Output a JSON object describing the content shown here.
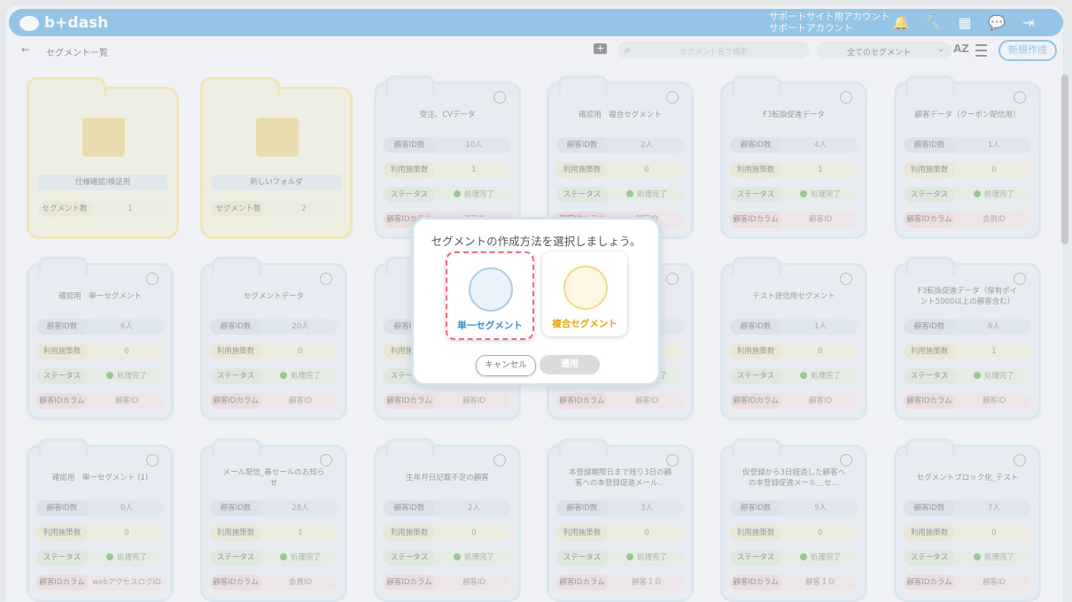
{
  "header": {
    "logo_text": "b+dash",
    "account_line1": "サポートサイト用アカウント",
    "account_line2": "サポートアカウント",
    "icons": [
      "bell-icon",
      "wrench-icon",
      "grid-icon",
      "chat-icon",
      "logout-icon"
    ]
  },
  "toolbar": {
    "back_glyph": "←",
    "breadcrumb": "セグメント一覧",
    "search_placeholder": "セグメント名で検索",
    "filter_value": "全てのセグメント",
    "sort_label": "AZ",
    "new_label": "新規作成"
  },
  "folders": [
    {
      "name": "仕様確認/検証用",
      "count_label": "セグメント数",
      "count": "1"
    },
    {
      "name": "新しいフォルダ",
      "count_label": "セグメント数",
      "count": "2"
    }
  ],
  "labels": {
    "id_count": "顧客ID数",
    "usage": "利用施策数",
    "status": "ステータス",
    "id_column": "顧客IDカラム",
    "done": "処理完了"
  },
  "cards_row1": [
    {
      "title": "受注、CVデータ",
      "ids": "10人",
      "usage": "1",
      "column": "顧客ID"
    },
    {
      "title": "確認用　複合セグメント",
      "ids": "2人",
      "usage": "0",
      "column": "顧客ID"
    },
    {
      "title": "F3転換促進データ",
      "ids": "4人",
      "usage": "1",
      "column": "顧客ID"
    },
    {
      "title": "顧客データ（クーポン配信用）",
      "ids": "1人",
      "usage": "0",
      "column": "会員ID"
    }
  ],
  "cards_row2": [
    {
      "title": "確認用　単一セグメント",
      "ids": "6人",
      "usage": "0",
      "column": "顧客ID"
    },
    {
      "title": "セグメントデータ",
      "ids": "20人",
      "usage": "0",
      "column": "顧客ID"
    },
    {
      "title": "",
      "ids": "",
      "usage": "",
      "column": "顧客ID"
    },
    {
      "title": "",
      "ids": "",
      "usage": "",
      "column": "顧客ID"
    },
    {
      "title": "テスト送信用セグメント",
      "ids": "1人",
      "usage": "0",
      "column": "顧客ID"
    },
    {
      "title": "F3転換促進データ（保有ポイント5000以上の顧客含む）",
      "ids": "6人",
      "usage": "1",
      "column": "顧客ID"
    }
  ],
  "cards_row3": [
    {
      "title": "確認用　単一セグメント (1)",
      "ids": "0人",
      "usage": "0",
      "column": "webアクセスログID"
    },
    {
      "title": "メール配信_春セールのお知らせ",
      "ids": "28人",
      "usage": "1",
      "column": "会員ID"
    },
    {
      "title": "生年月日記載不足の顧客",
      "ids": "2人",
      "usage": "0",
      "column": "顧客ID"
    },
    {
      "title": "本登録期限日まで残り3日の顧客への本登録促進メール…",
      "ids": "3人",
      "usage": "0",
      "column": "顧客ＩＤ"
    },
    {
      "title": "仮登録から3日経過した顧客への本登録促進メール＿セ…",
      "ids": "5人",
      "usage": "0",
      "column": "顧客ＩＤ"
    },
    {
      "title": "セグメントブロック化_テスト",
      "ids": "7人",
      "usage": "0",
      "column": "顧客ID"
    }
  ],
  "modal": {
    "title": "セグメントの作成方法を選択しましょう。",
    "single_label": "単一セグメント",
    "multi_label": "複合セグメント",
    "cancel_label": "キャンセル",
    "apply_label": "適用"
  }
}
